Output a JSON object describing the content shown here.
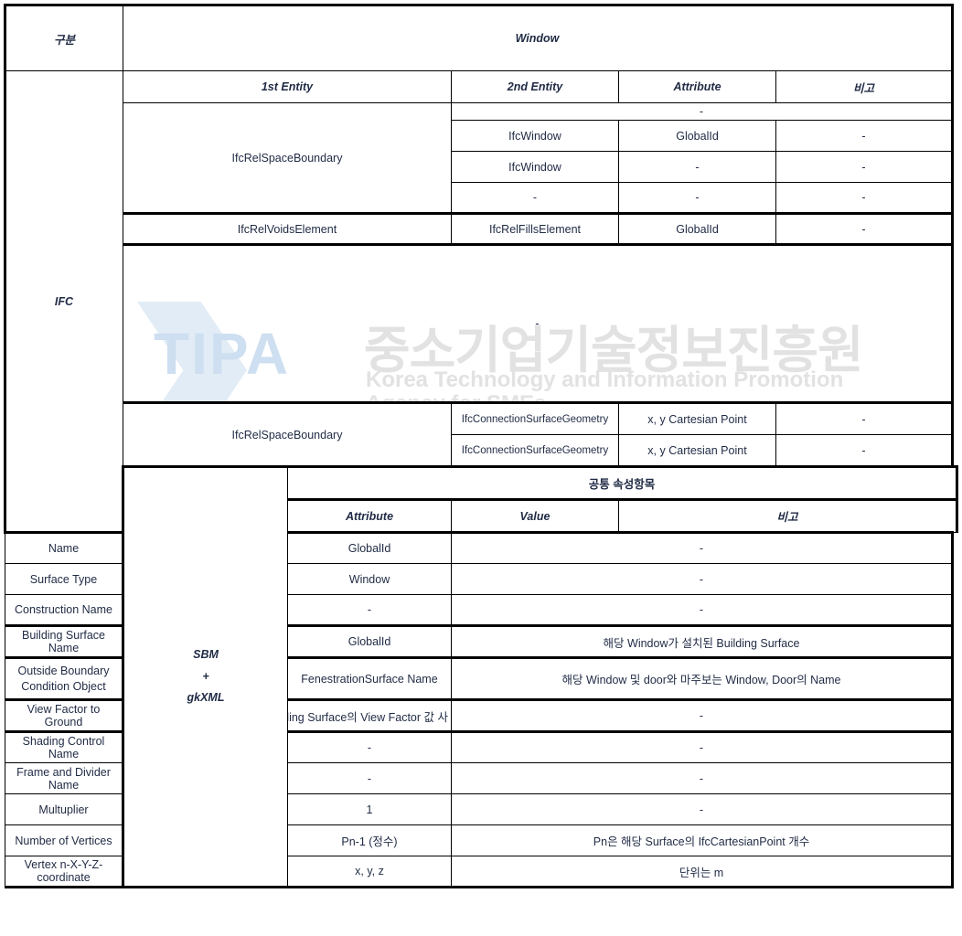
{
  "watermark": {
    "logo_text": "TIPA",
    "korean_name": "중소기업기술정보진흥원",
    "english_line1": "Korea Technology and Information Promotion",
    "english_line2": "Agency for SMEs"
  },
  "colors": {
    "title_bg": "#FFC000",
    "ifc_side_bg": "#00B050",
    "sbm_side_bg": "#FFFF00",
    "header_grey": "#D9D9D9",
    "header_pink": "#F2DCDB",
    "accent_green_text": "#00B050"
  },
  "table": {
    "corner_label": "구분",
    "title": "Window",
    "ifc": {
      "side_label": "IFC",
      "columns": [
        "1st Entity",
        "2nd Entity",
        "Attribute",
        "비고"
      ],
      "merged_dash_top": "-",
      "group1": {
        "first_entity": "IfcRelSpaceBoundary",
        "rows": [
          {
            "second_entity": "IfcWindow",
            "attribute": "GlobalId",
            "note": "-"
          },
          {
            "second_entity": "IfcWindow",
            "attribute": "-",
            "note": "-"
          },
          {
            "second_entity": "-",
            "attribute": "-",
            "note": "-"
          }
        ]
      },
      "group2": {
        "first_entity": "IfcRelVoidsElement",
        "second_entity": "IfcRelFillsElement",
        "attribute": "GlobalId",
        "note": "-"
      },
      "merged_dash_middle": "-",
      "group3": {
        "first_entity": "IfcRelSpaceBoundary",
        "rows": [
          {
            "second_entity": "IfcConnectionSurfaceGeometry",
            "attribute": "x, y Cartesian Point",
            "note": "-"
          },
          {
            "second_entity": "IfcConnectionSurfaceGeometry",
            "attribute": "x, y Cartesian Point",
            "note": "-"
          }
        ]
      }
    },
    "sbm": {
      "side_label_line1": "SBM",
      "side_label_line2": "+",
      "side_label_line3": "gkXML",
      "section_title": "공통 속성항목",
      "columns": [
        "Attribute",
        "Value",
        "비고"
      ],
      "rows": [
        {
          "attribute": "Name",
          "value": "GlobalId",
          "note": "-",
          "highlight": false
        },
        {
          "attribute": "Surface Type",
          "value": "Window",
          "note": "-",
          "highlight": false
        },
        {
          "attribute": "Construction Name",
          "value": "-",
          "note": "-",
          "highlight": false
        },
        {
          "attribute": "Building Surface Name",
          "value": "GlobalId",
          "note": "해당 Window가 설치된 Building Surface",
          "highlight": false
        },
        {
          "attribute": "Outside Boundary Condition Object",
          "attribute_line1": "Outside Boundary",
          "attribute_line2": "Condition Object",
          "value": "FenestrationSurface Name",
          "note": "해당 Window 및 door와 마주보는 Window, Door의 Name",
          "highlight": true
        },
        {
          "attribute": "View Factor to Ground",
          "value": "ding Surface의 View Factor 값 사",
          "note": "-",
          "highlight": false,
          "clipped": true
        },
        {
          "attribute": "Shading Control Name",
          "value": "-",
          "note": "-",
          "highlight": false
        },
        {
          "attribute": "Frame and Divider Name",
          "value": "-",
          "note": "-",
          "highlight": false
        },
        {
          "attribute": "Multuplier",
          "value": "1",
          "note": "-",
          "highlight": false
        },
        {
          "attribute": "Number of Vertices",
          "value": "Pn-1 (정수)",
          "note": "Pn은 해당 Surface의 IfcCartesianPoint 개수",
          "highlight": false
        },
        {
          "attribute": "Vertex n-X-Y-Z-coordinate",
          "value": "x, y, z",
          "note": "단위는 m",
          "highlight": false
        }
      ]
    }
  }
}
